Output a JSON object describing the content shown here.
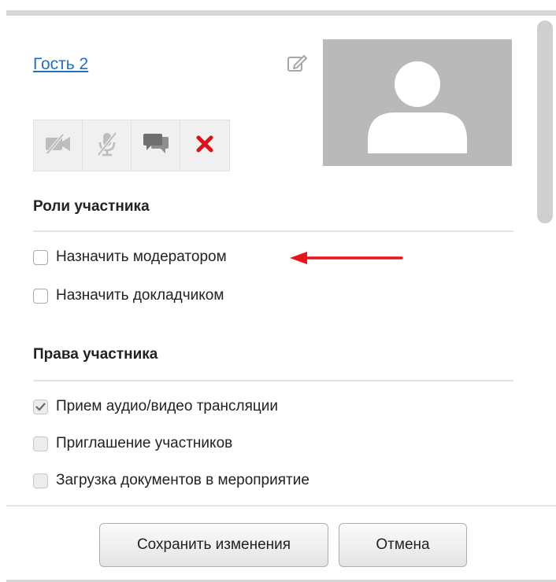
{
  "participant": {
    "name": "Гость 2"
  },
  "roles": {
    "title": "Роли участника",
    "items": [
      {
        "label": "Назначить модератором",
        "checked": false
      },
      {
        "label": "Назначить докладчиком",
        "checked": false
      }
    ]
  },
  "rights": {
    "title": "Права участника",
    "items": [
      {
        "label": "Прием аудио/видео трансляции",
        "checked": true
      },
      {
        "label": "Приглашение участников",
        "checked": false
      },
      {
        "label": "Загрузка документов в мероприятие",
        "checked": false
      }
    ]
  },
  "toolbar": {
    "icons": [
      "video-off-icon",
      "mic-off-icon",
      "chat-icon",
      "remove-icon"
    ]
  },
  "actions": {
    "save_label": "Сохранить изменения",
    "cancel_label": "Отмена"
  },
  "colors": {
    "link": "#1f6fc2",
    "annotation_arrow": "#e8141b",
    "remove_icon": "#d9131a"
  }
}
